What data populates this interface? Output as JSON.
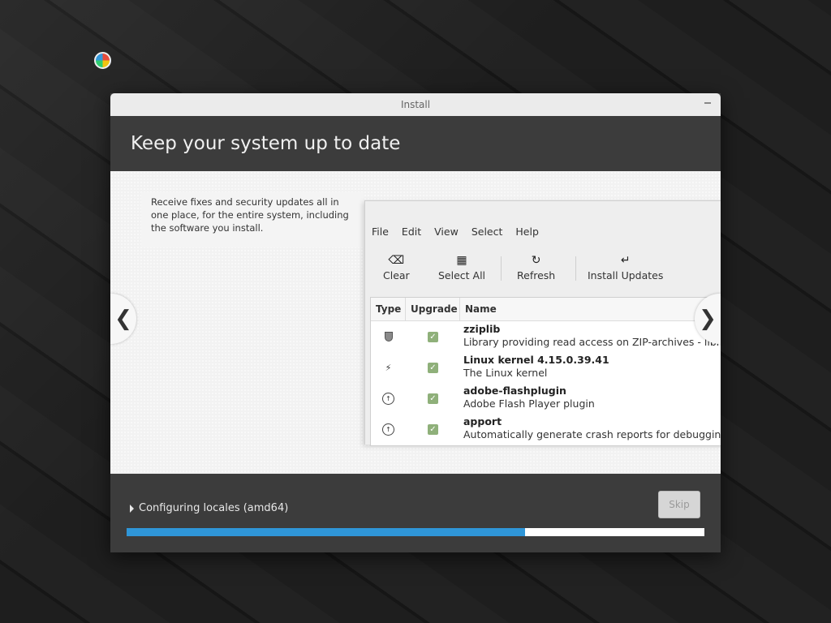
{
  "window": {
    "title": "Install"
  },
  "header": {
    "title": "Keep your system up to date"
  },
  "slide": {
    "description": "Receive fixes and security updates all in one place, for the entire system, including the software you install.",
    "menu": [
      "File",
      "Edit",
      "View",
      "Select",
      "Help"
    ],
    "toolbar": [
      {
        "label": "Clear",
        "icon": "backspace-icon"
      },
      {
        "label": "Select All",
        "icon": "select-all-icon"
      },
      {
        "label": "Refresh",
        "icon": "refresh-icon"
      },
      {
        "label": "Install Updates",
        "icon": "enter-icon"
      }
    ],
    "columns": [
      "Type",
      "Upgrade",
      "Name"
    ],
    "rows": [
      {
        "type_icon": "shield-icon",
        "name": "zziplib",
        "desc": "Library providing read access on ZIP-archives - library",
        "checked": true
      },
      {
        "type_icon": "bolt-icon",
        "name": "Linux kernel 4.15.0.39.41",
        "desc": "The Linux kernel",
        "checked": true
      },
      {
        "type_icon": "upgrade-arrow-icon",
        "name": "adobe-flashplugin",
        "desc": "Adobe Flash Player plugin",
        "checked": true
      },
      {
        "type_icon": "upgrade-arrow-icon",
        "name": "apport",
        "desc": "Automatically generate crash reports for debugging",
        "checked": true
      }
    ]
  },
  "footer": {
    "status": "Configuring locales (amd64)",
    "skip_label": "Skip",
    "progress": 0.69
  },
  "colors": {
    "accent": "#2f96d8",
    "checkbox": "#8fb07a",
    "header_bg": "#3c3c3c"
  }
}
